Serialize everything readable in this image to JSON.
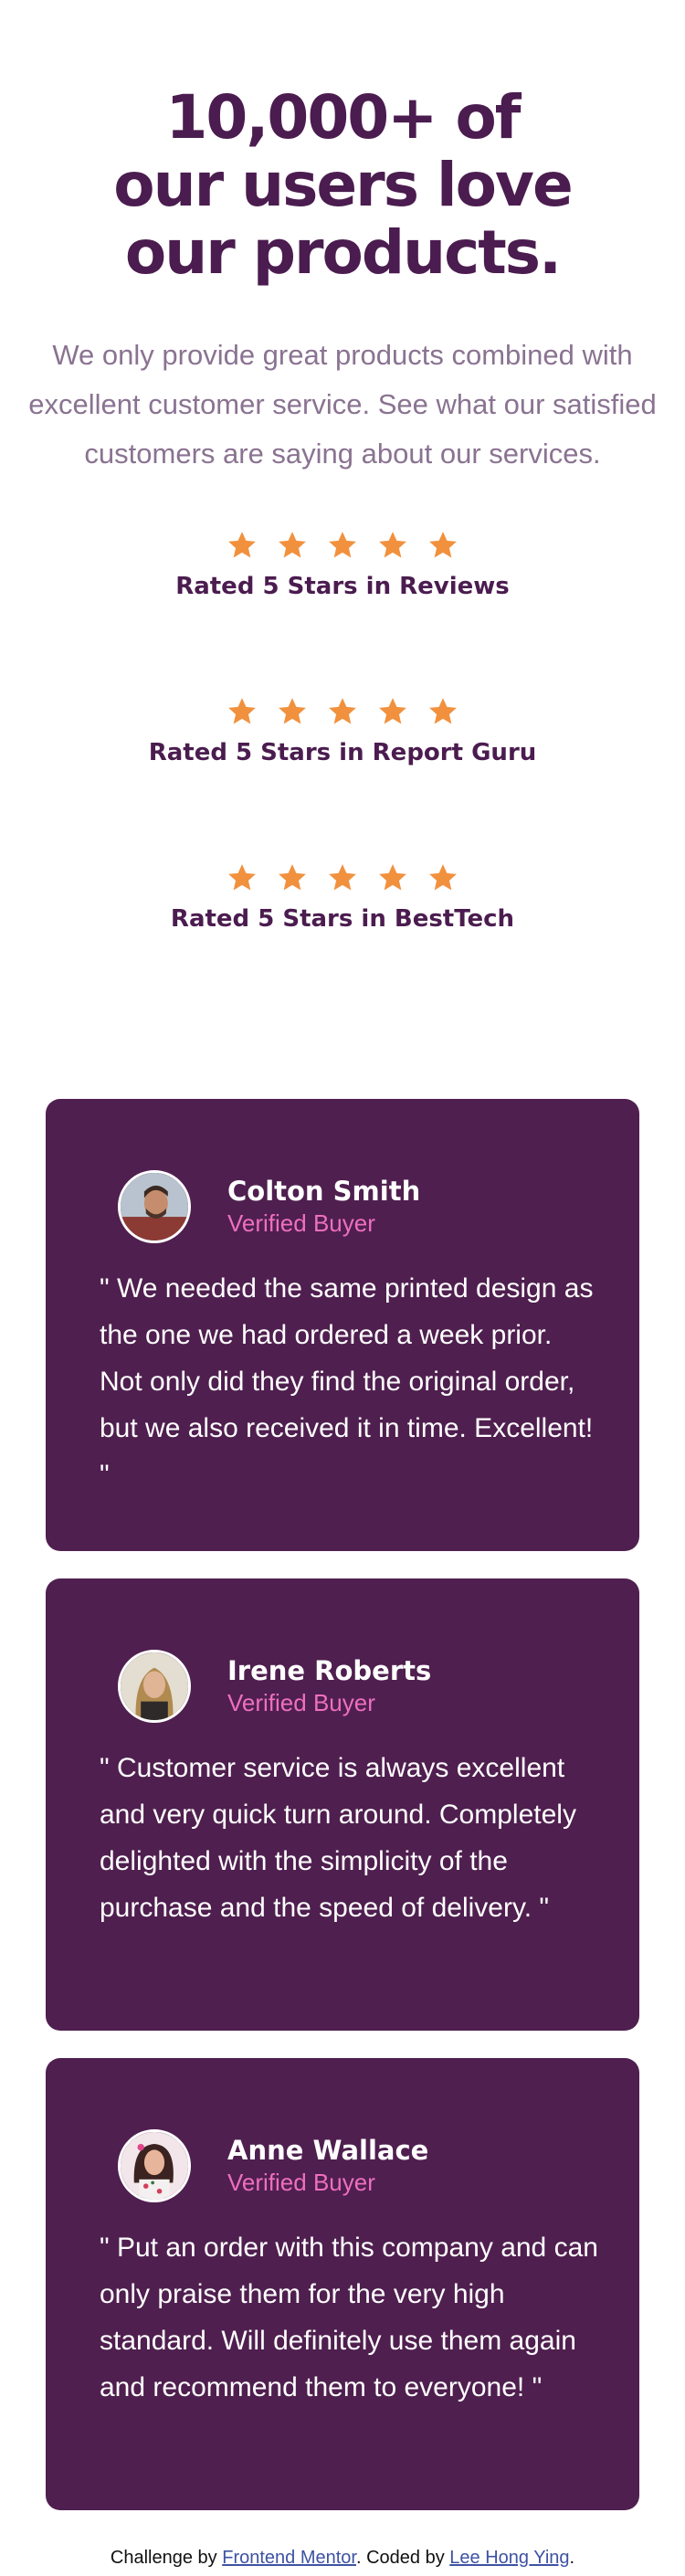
{
  "hero": {
    "title": "10,000+ of our users love our products.",
    "text": "We only provide great products combined with excellent customer service. See what our satisfied customers are saying about our services."
  },
  "ratings": [
    {
      "label": "Rated 5 Stars in Reviews",
      "stars": 5
    },
    {
      "label": "Rated 5 Stars in Report Guru",
      "stars": 5
    },
    {
      "label": "Rated 5 Stars in BestTech",
      "stars": 5
    }
  ],
  "testimonials": [
    {
      "name": "Colton Smith",
      "status": "Verified Buyer",
      "quote": "\" We needed the same printed design as the one we had ordered a week prior. Not only did they find the original order, but we also received it in time. Excellent! \""
    },
    {
      "name": "Irene Roberts",
      "status": "Verified Buyer",
      "quote": "\" Customer service is always excellent and very quick turn around. Completely delighted with the simplicity of the purchase and the speed of delivery. \""
    },
    {
      "name": "Anne Wallace",
      "status": "Verified Buyer",
      "quote": "\" Put an order with this company and can only praise them for the very high standard. Will definitely use them again and recommend them to everyone! \""
    }
  ],
  "attribution": {
    "prefix": "Challenge by ",
    "link1": "Frontend Mentor",
    "middle": ". Coded by ",
    "link2": "Lee Hong Ying",
    "suffix": "."
  },
  "colors": {
    "primary": "#4b1c4f",
    "card": "#4f1f4f",
    "accent": "#ee6fbf",
    "star": "#f1913e",
    "muted": "#8a7391"
  },
  "icons": {
    "star": "star-icon",
    "avatar": "avatar"
  }
}
